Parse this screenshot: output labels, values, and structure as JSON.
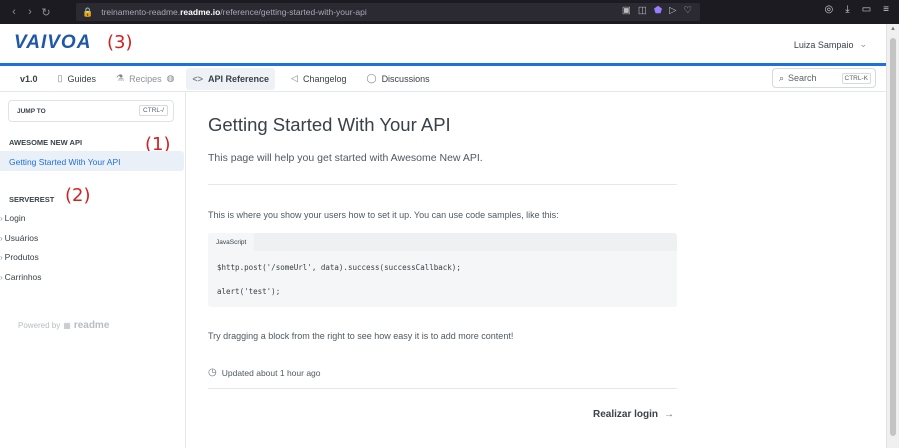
{
  "browser": {
    "url_prefix": "treinamento-readme.",
    "url_domain": "readme.io",
    "url_path": "/reference/getting-started-with-your-api"
  },
  "header": {
    "logo": "VAIVOA",
    "annotation": "(3)",
    "user": "Luiza Sampaio"
  },
  "nav": {
    "version": "v1.0",
    "items": [
      {
        "label": "Guides",
        "icon": "book-icon"
      },
      {
        "label": "Recipes",
        "icon": "flask-icon"
      },
      {
        "label": "API Reference",
        "icon": "code-icon"
      },
      {
        "label": "Changelog",
        "icon": "megaphone-icon"
      },
      {
        "label": "Discussions",
        "icon": "chat-icon"
      }
    ],
    "search_label": "Search",
    "search_shortcut": "CTRL-K"
  },
  "sidebar": {
    "jump_to": "JUMP TO",
    "jump_shortcut": "CTRL-/",
    "section1": "AWESOME NEW API",
    "section1_annotation": "(1)",
    "active_item": "Getting Started With Your API",
    "section2": "SERVEREST",
    "section2_annotation": "(2)",
    "links": [
      "Login",
      "Usuários",
      "Produtos",
      "Carrinhos"
    ],
    "powered_by": "Powered by",
    "powered_brand": "readme"
  },
  "main": {
    "title": "Getting Started With Your API",
    "subtitle": "This page will help you get started with Awesome New API.",
    "intro": "This is where you show your users how to set it up. You can use code samples, like this:",
    "code_tab": "JavaScript",
    "code_line1": "$http.post('/someUrl', data).success(successCallback);",
    "code_line2": "alert('test');",
    "drag_text": "Try dragging a block from the right to see how easy it is to add more content!",
    "updated": "Updated about 1 hour ago",
    "next_label": "Realizar login"
  }
}
